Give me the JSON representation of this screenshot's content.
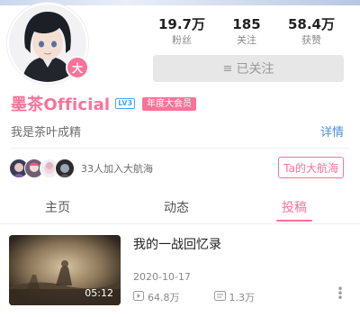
{
  "profile": {
    "username": "墨茶Official",
    "level": "LV3",
    "vip_label": "年度大会员",
    "avatar_badge": "大",
    "sign": "我是茶叶成精",
    "detail_link": "详情"
  },
  "stats": [
    {
      "value": "19.7万",
      "label": "粉丝"
    },
    {
      "value": "185",
      "label": "关注"
    },
    {
      "value": "58.4万",
      "label": "获赞"
    }
  ],
  "follow_button": {
    "icon": "≡",
    "label": "已关注"
  },
  "voyage": {
    "text": "33人加入大航海",
    "button_label": "Ta的大航海"
  },
  "tabs": [
    {
      "label": "主页",
      "active": false
    },
    {
      "label": "动态",
      "active": false
    },
    {
      "label": "投稿",
      "active": true
    }
  ],
  "video": {
    "title": "我的一战回忆录",
    "date": "2020-10-17",
    "duration": "05:12",
    "plays": "64.8万",
    "danmaku": "1.3万"
  },
  "colors": {
    "accent_pink": "#fb7299",
    "link_blue": "#4a90e2",
    "muted_gray": "#888888"
  }
}
